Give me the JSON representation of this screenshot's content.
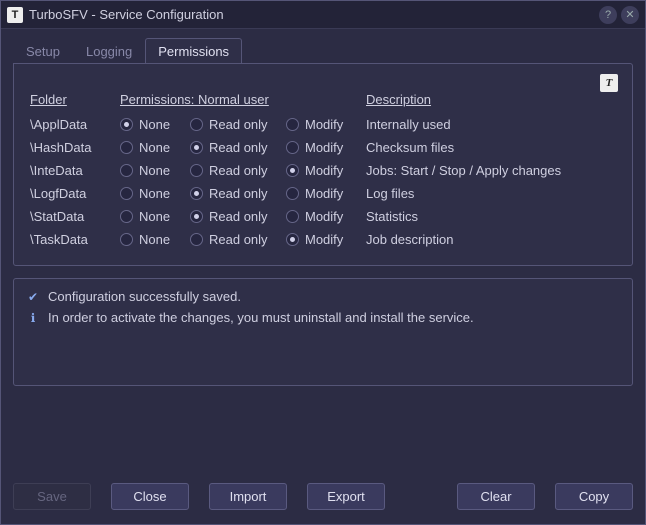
{
  "window": {
    "title": "TurboSFV - Service Configuration",
    "app_icon_letter": "T"
  },
  "tabs": {
    "setup": "Setup",
    "logging": "Logging",
    "permissions": "Permissions",
    "active": "permissions"
  },
  "headers": {
    "folder": "Folder",
    "permissions": "Permissions: Normal user",
    "description": "Description"
  },
  "radio_labels": {
    "none": "None",
    "readonly": "Read only",
    "modify": "Modify"
  },
  "rows": [
    {
      "folder": "\\ApplData",
      "perm": "none",
      "desc": "Internally used"
    },
    {
      "folder": "\\HashData",
      "perm": "readonly",
      "desc": "Checksum files"
    },
    {
      "folder": "\\InteData",
      "perm": "modify",
      "desc": "Jobs: Start / Stop / Apply changes"
    },
    {
      "folder": "\\LogfData",
      "perm": "readonly",
      "desc": "Log files"
    },
    {
      "folder": "\\StatData",
      "perm": "readonly",
      "desc": "Statistics"
    },
    {
      "folder": "\\TaskData",
      "perm": "modify",
      "desc": "Job description"
    }
  ],
  "messages": {
    "saved": "Configuration successfully saved.",
    "activate": "In order to activate the changes, you must uninstall and install the service."
  },
  "buttons": {
    "save": "Save",
    "close": "Close",
    "import": "Import",
    "export": "Export",
    "clear": "Clear",
    "copy": "Copy"
  }
}
